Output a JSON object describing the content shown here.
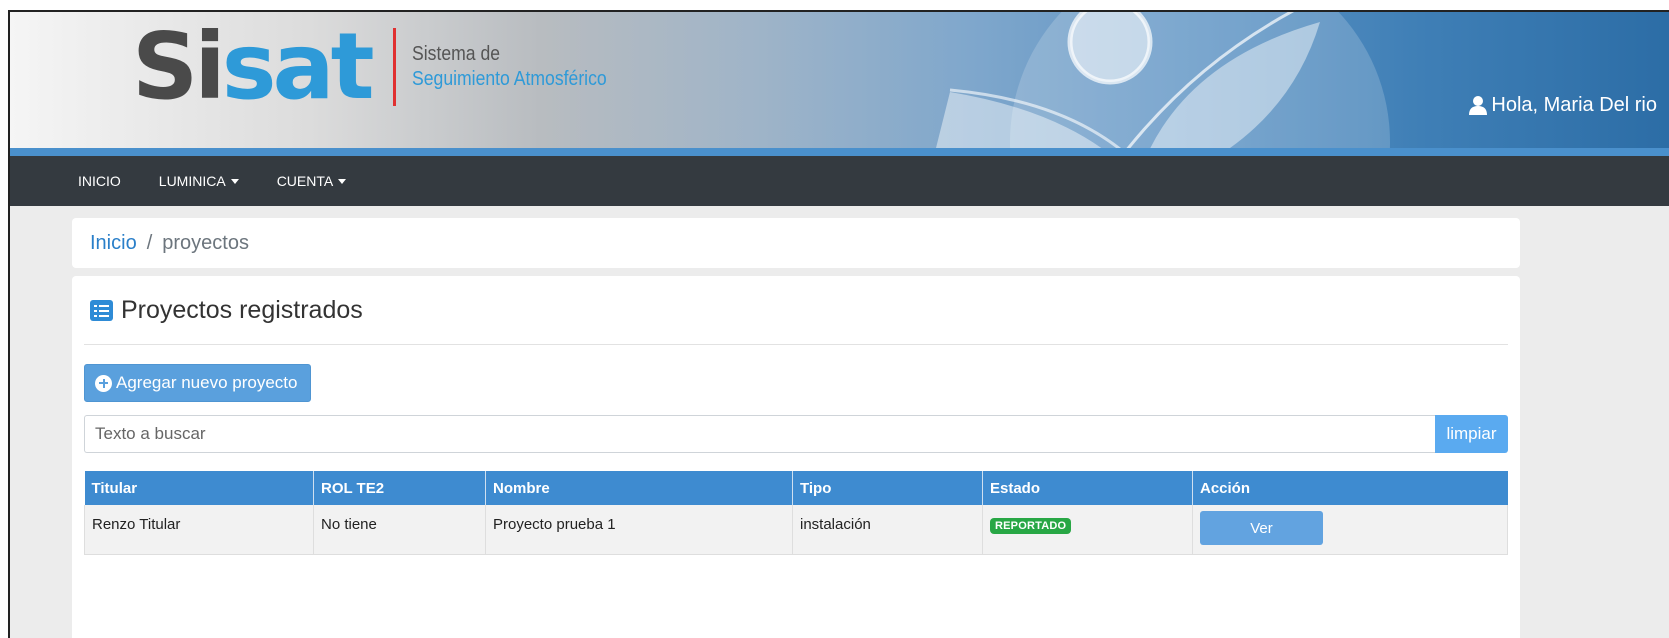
{
  "header": {
    "logo_si": "Si",
    "logo_sat": "sat",
    "logo_line1": "Sistema de",
    "logo_line2": "Seguimiento Atmosférico",
    "greeting": "Hola, Maria Del rio",
    "user_icon": "user-icon"
  },
  "nav": {
    "items": [
      {
        "label": "INICIO",
        "dropdown": false
      },
      {
        "label": "LUMINICA",
        "dropdown": true
      },
      {
        "label": "CUENTA",
        "dropdown": true
      }
    ]
  },
  "breadcrumb": {
    "home": "Inicio",
    "separator": "/",
    "current": "proyectos"
  },
  "main": {
    "title": "Proyectos registrados",
    "title_icon": "list-icon",
    "add_button": "Agregar nuevo proyecto",
    "search": {
      "placeholder": "Texto a buscar",
      "value": ""
    },
    "clear_button": "limpiar",
    "table": {
      "columns": [
        "Titular",
        "ROL TE2",
        "Nombre",
        "Tipo",
        "Estado",
        "Acción"
      ],
      "rows": [
        {
          "titular": "Renzo Titular",
          "rol": "No tiene",
          "nombre": "Proyecto prueba 1",
          "tipo": "instalación",
          "estado": "REPORTADO",
          "accion": "Ver"
        }
      ]
    }
  },
  "colors": {
    "accent": "#3e8bd0",
    "navbar": "#343a40",
    "badge_success": "#28a745",
    "logo_blue": "#2e9ad8",
    "logo_red": "#e03030"
  }
}
